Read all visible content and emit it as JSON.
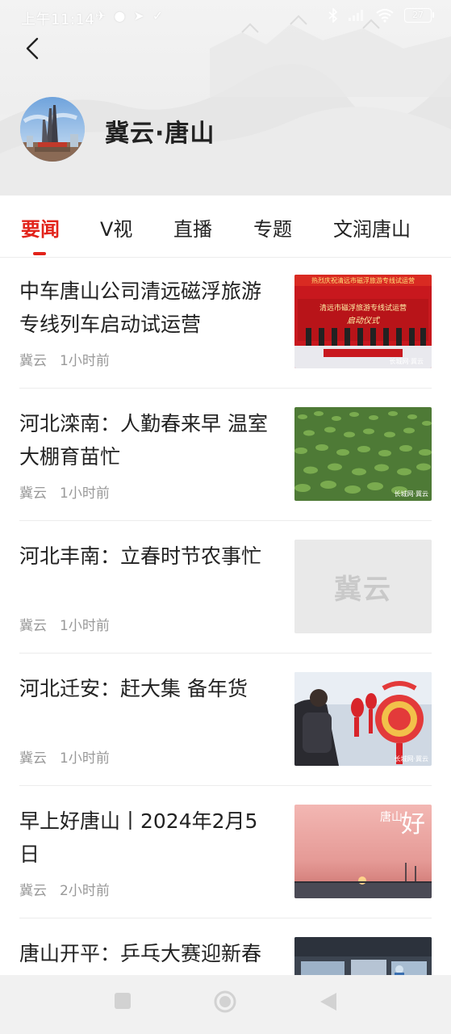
{
  "status_bar": {
    "time": "上午11:14",
    "battery": "27"
  },
  "header": {
    "channel_title": "冀云·唐山"
  },
  "tabs": [
    {
      "label": "要闻",
      "active": true
    },
    {
      "label": "V视",
      "active": false
    },
    {
      "label": "直播",
      "active": false
    },
    {
      "label": "专题",
      "active": false
    },
    {
      "label": "文润唐山",
      "active": false
    }
  ],
  "news": [
    {
      "title": "中车唐山公司清远磁浮旅游专线列车启动试运营",
      "source": "冀云",
      "time": "1小时前"
    },
    {
      "title": "河北滦南：人勤春来早 温室大棚育苗忙",
      "source": "冀云",
      "time": "1小时前"
    },
    {
      "title": "河北丰南：立春时节农事忙",
      "source": "冀云",
      "time": "1小时前"
    },
    {
      "title": "河北迁安：赶大集 备年货",
      "source": "冀云",
      "time": "1小时前"
    },
    {
      "title": "早上好唐山丨2024年2月5日",
      "source": "冀云",
      "time": "2小时前"
    },
    {
      "title": "唐山开平：乒乓大赛迎新春",
      "source": "",
      "time": ""
    }
  ],
  "thumbs": {
    "banner_line1": "热烈庆祝清远市磁浮旅游专线试运营",
    "banner_line2": "清远市磁浮旅游专线试运营",
    "banner_line3": "启动仪式",
    "watermark": "长城网·冀云",
    "placeholder_logo": "冀云",
    "good_morning_small": "唐山",
    "good_morning_big": "好"
  },
  "colors": {
    "accent": "#e2231a",
    "meta": "#999999"
  }
}
